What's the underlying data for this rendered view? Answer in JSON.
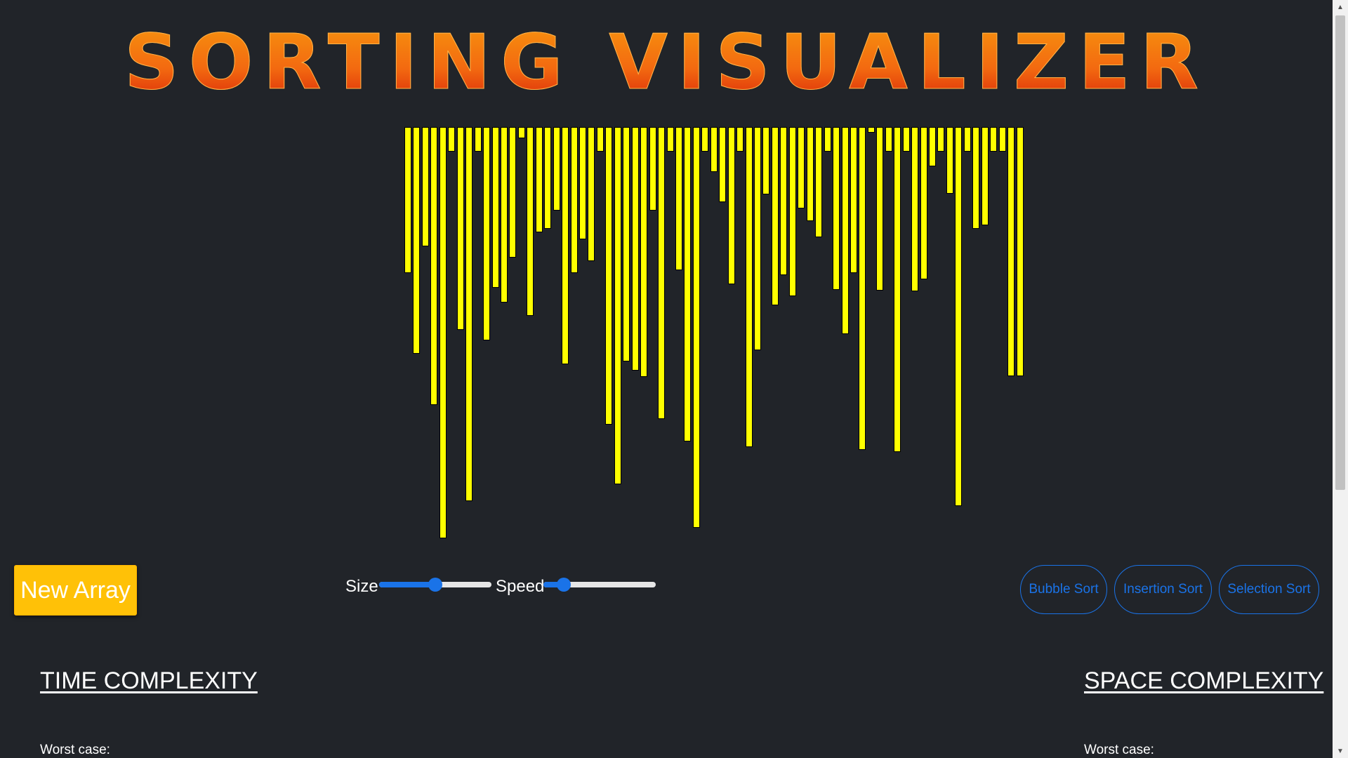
{
  "header": {
    "title": "SORTING VISUALIZER"
  },
  "array": {
    "bar_values": [
      173,
      269,
      142,
      330,
      488,
      29,
      241,
      444,
      29,
      253,
      191,
      208,
      155,
      13,
      224,
      125,
      121,
      99,
      282,
      173,
      133,
      159,
      29,
      353,
      424,
      278,
      289,
      297,
      99,
      347,
      29,
      170,
      373,
      476,
      29,
      53,
      89,
      187,
      29,
      380,
      265,
      80,
      212,
      176,
      201,
      97,
      112,
      131,
      29,
      193,
      246,
      173,
      383,
      7,
      194,
      29,
      386,
      29,
      195,
      181,
      47,
      29,
      79,
      450,
      29,
      121,
      117,
      29,
      29,
      296,
      296
    ],
    "bar_color": "#ffff00"
  },
  "controls": {
    "new_array_label": "New Array",
    "size_label": "Size",
    "speed_label": "Speed",
    "size_level": 0.5,
    "speed_level": 0.18,
    "accent_color": "#1a73e8"
  },
  "algorithms": {
    "bubble": "Bubble Sort",
    "insertion": "Insertion Sort",
    "selection": "Selection Sort"
  },
  "complexity": {
    "time_heading": "TIME COMPLEXITY",
    "space_heading": "SPACE COMPLEXITY",
    "time_worst_label": "Worst case:",
    "space_worst_label": "Worst case:"
  }
}
